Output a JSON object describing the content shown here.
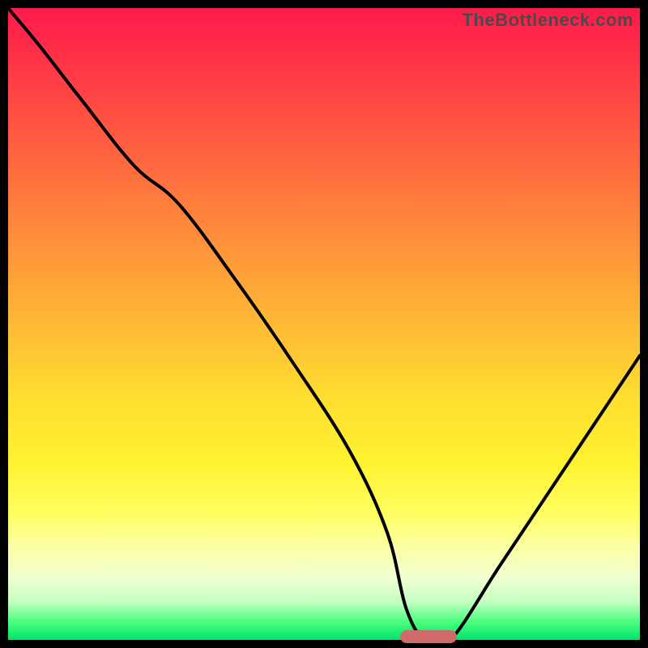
{
  "watermark_text": "TheBottleneck.com",
  "colors": {
    "frame": "#000000",
    "curve": "#000000",
    "marker": "#cf6b6b",
    "gradient_top": "#ff1a4b",
    "gradient_bottom": "#00e46a"
  },
  "chart_data": {
    "type": "line",
    "title": "",
    "xlabel": "",
    "ylabel": "",
    "xlim": [
      0,
      100
    ],
    "ylim": [
      0,
      100
    ],
    "grid": false,
    "axes_visible": false,
    "notes": "Bottleneck-style gradient plot. Y ≈ bottleneck % (100 at top → 0 at bottom). X is a hidden component-range axis. Curve dips to ~0 near x≈66 (optimal zone marked by pill).",
    "series": [
      {
        "name": "bottleneck-curve",
        "x": [
          0,
          5,
          12,
          20,
          27,
          36,
          45,
          54,
          60,
          63,
          66,
          70,
          78,
          88,
          100
        ],
        "values": [
          100,
          94,
          85,
          75,
          69,
          57,
          44,
          30,
          17,
          5,
          0,
          0,
          12,
          27,
          45
        ]
      }
    ],
    "optimal_range": {
      "x_start": 62,
      "x_end": 71,
      "y": 0
    }
  }
}
